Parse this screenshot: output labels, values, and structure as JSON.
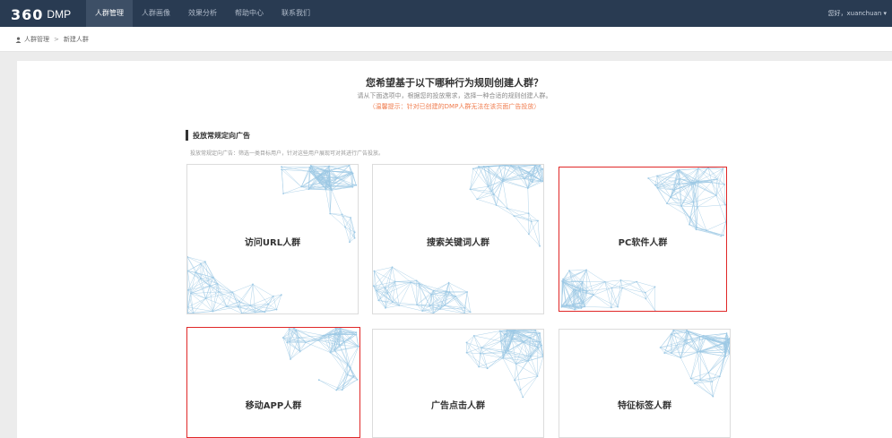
{
  "header": {
    "logo_number": "360",
    "logo_text": "DMP",
    "nav": [
      "人群管理",
      "人群画像",
      "效果分析",
      "帮助中心",
      "联系我们"
    ],
    "user": "您好，xuanchuan ▾"
  },
  "breadcrumb": {
    "home": "人群管理",
    "separator": ">",
    "current": "新建人群"
  },
  "main": {
    "title": "您希望基于以下哪种行为规则创建人群？",
    "subtitle": "请从下面选项中，根据您的投放需求，选择一种合适的规则创建人群。",
    "warning": "（温馨提示：针对已创建的DMP人群无法在该页面广告投放）",
    "section_title": "投放常规定向广告",
    "section_desc": "投放常规定向广告：筛选一类目标用户，针对这些用户展现可对其进行广告投放。"
  },
  "cards": [
    {
      "label": "访问URL人群",
      "selected": false
    },
    {
      "label": "搜索关键词人群",
      "selected": false
    },
    {
      "label": "PC软件人群",
      "selected": true
    },
    {
      "label": "移动APP人群",
      "selected": true
    },
    {
      "label": "广告点击人群",
      "selected": false
    },
    {
      "label": "特征标签人群",
      "selected": false
    }
  ],
  "colors": {
    "topbar": "#293b52",
    "nav_active": "#3d4f66",
    "selection": "#e02828",
    "warning": "#f07c4e",
    "network": "#9cc8e4"
  }
}
